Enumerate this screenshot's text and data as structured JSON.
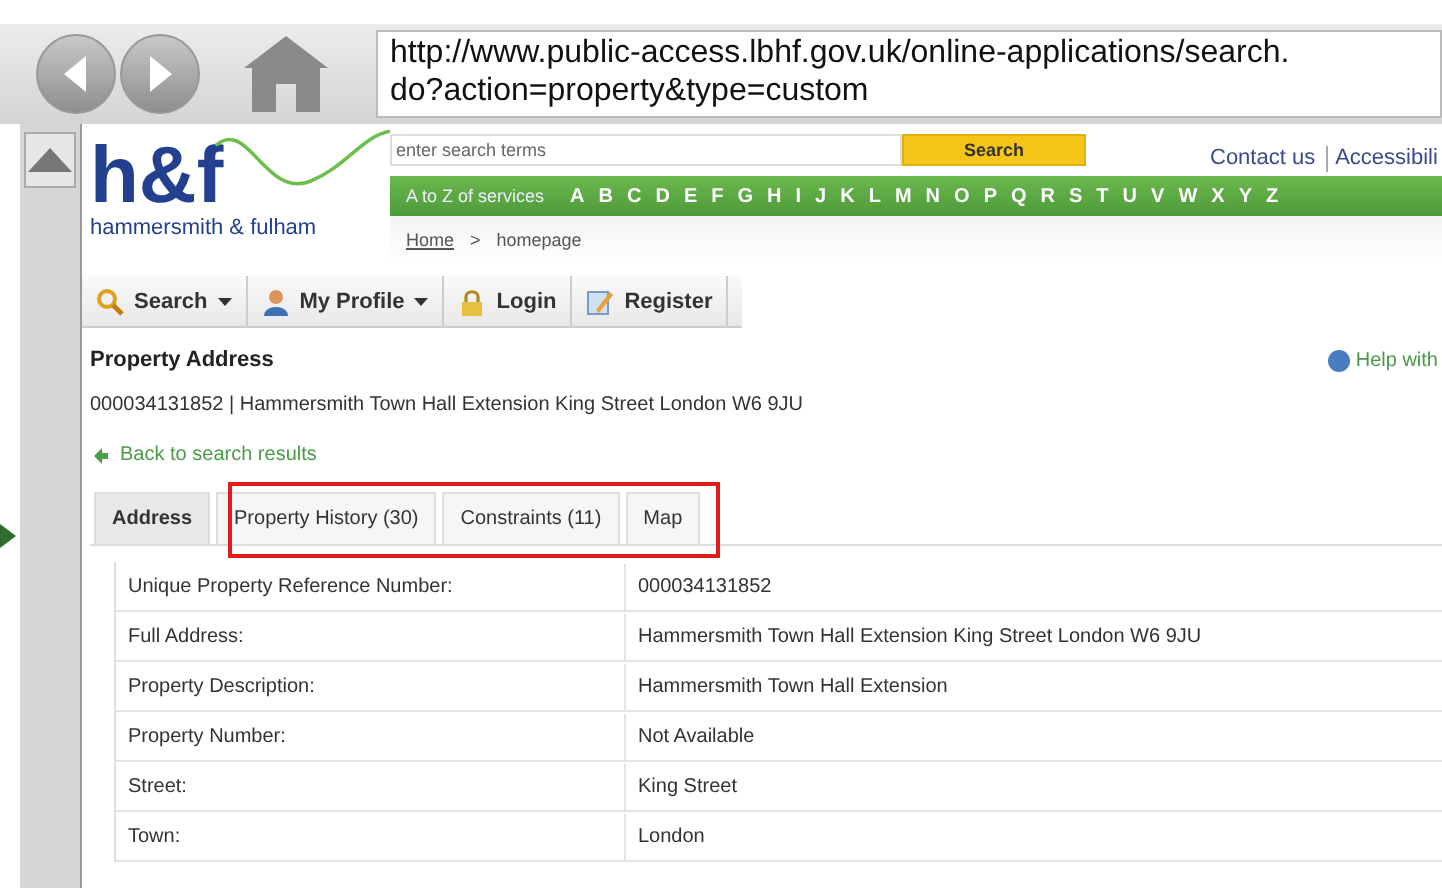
{
  "browser": {
    "url_line_1": "http://www.public-access.lbhf.gov.uk/online-applications/search.",
    "url_line_2": "do?action=property&type=custom"
  },
  "header": {
    "logo_text": "h&f",
    "logo_subtitle": "hammersmith & fulham",
    "search": {
      "placeholder": "enter search terms",
      "button": "Search"
    },
    "links": [
      "Contact us",
      "Accessibili"
    ],
    "az_label": "A to Z of services",
    "letters": [
      "A",
      "B",
      "C",
      "D",
      "E",
      "F",
      "G",
      "H",
      "I",
      "J",
      "K",
      "L",
      "M",
      "N",
      "O",
      "P",
      "Q",
      "R",
      "S",
      "T",
      "U",
      "V",
      "W",
      "X",
      "Y",
      "Z"
    ],
    "breadcrumb": [
      "Home",
      ">",
      "homepage"
    ]
  },
  "toolbar": [
    {
      "label": "Search",
      "kind": "search",
      "dropdown": true
    },
    {
      "label": "My Profile",
      "kind": "profile",
      "dropdown": true
    },
    {
      "label": "Login",
      "kind": "login",
      "dropdown": false
    },
    {
      "label": "Register",
      "kind": "register",
      "dropdown": false
    }
  ],
  "title": "Property Address",
  "help": "Help with",
  "reference": "000034131852 | Hammersmith Town Hall Extension King Street London W6 9JU",
  "back_link": "Back to search results",
  "tabs": [
    {
      "label": "Address",
      "selected": true
    },
    {
      "label": "Property History (30)",
      "selected": false
    },
    {
      "label": "Constraints (11)",
      "selected": false
    },
    {
      "label": "Map",
      "selected": false
    }
  ],
  "table": {
    "rows": [
      [
        "Unique Property Reference Number:",
        "000034131852"
      ],
      [
        "Full Address:",
        "Hammersmith Town Hall Extension King Street London W6 9JU"
      ],
      [
        "Property Description:",
        "Hammersmith Town Hall Extension"
      ],
      [
        "Property Number:",
        "Not Available"
      ],
      [
        "Street:",
        "King Street"
      ],
      [
        "Town:",
        "London"
      ]
    ]
  }
}
